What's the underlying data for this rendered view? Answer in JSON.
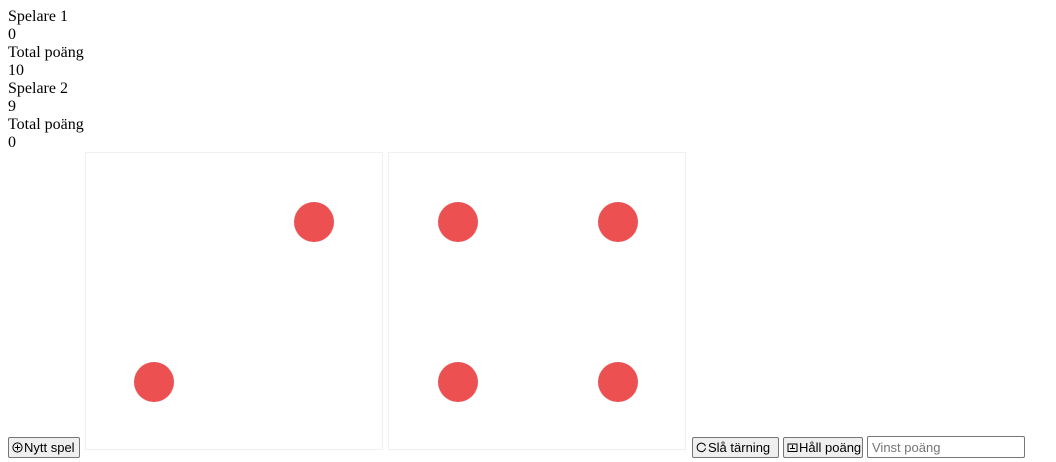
{
  "player1": {
    "name": "Spelare 1",
    "current": "0",
    "total_label": "Total poäng",
    "total": "10"
  },
  "player2": {
    "name": "Spelare 2",
    "current": "9",
    "total_label": "Total poäng",
    "total": "0"
  },
  "dice": [
    {
      "value": 2,
      "pip_color": "#ec5050"
    },
    {
      "value": 4,
      "pip_color": "#ec5050"
    }
  ],
  "controls": {
    "new_game_label": "Nytt spel",
    "new_game_icon": "plus-circle-icon",
    "roll_label": "Slå tärning",
    "roll_icon": "refresh-circle-icon",
    "hold_label": "Håll poäng",
    "hold_icon": "inbox-tray-icon",
    "win_points_placeholder": "Vinst poäng",
    "win_points_value": ""
  }
}
